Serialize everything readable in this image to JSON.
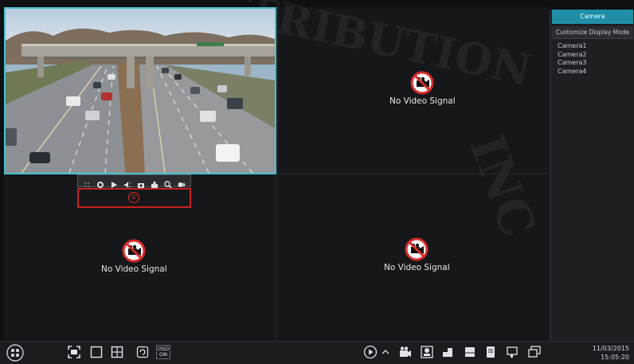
{
  "tiles": {
    "top_left": {
      "type": "live-video"
    },
    "top_right": {
      "no_signal_text": "No Video Signal"
    },
    "bottom_left": {
      "no_signal_text": "No Video Signal"
    },
    "bottom_right": {
      "no_signal_text": "No Video Signal"
    }
  },
  "camera_toolbar": {
    "icons": [
      "drag-handle-icon",
      "record-icon",
      "play-icon",
      "audio-icon",
      "snapshot-icon",
      "ptz-icon",
      "zoom-icon",
      "ptz-settings-icon"
    ]
  },
  "annotation": {
    "number": "①"
  },
  "right_panel": {
    "title": "Camera",
    "display_mode_label": "Customize Display Mode",
    "cameras": [
      "Camera1",
      "Camera2",
      "Camera3",
      "Camera4"
    ]
  },
  "taskbar": {
    "osd_top": "OSD",
    "osd_bottom": "ON",
    "date": "11/03/2015",
    "time": "15:05:20"
  },
  "colors": {
    "accent": "#1f8ea6",
    "selected_border": "#46c2d6",
    "annotation_red": "#c8231f",
    "no_signal_red": "#d62b2b"
  }
}
